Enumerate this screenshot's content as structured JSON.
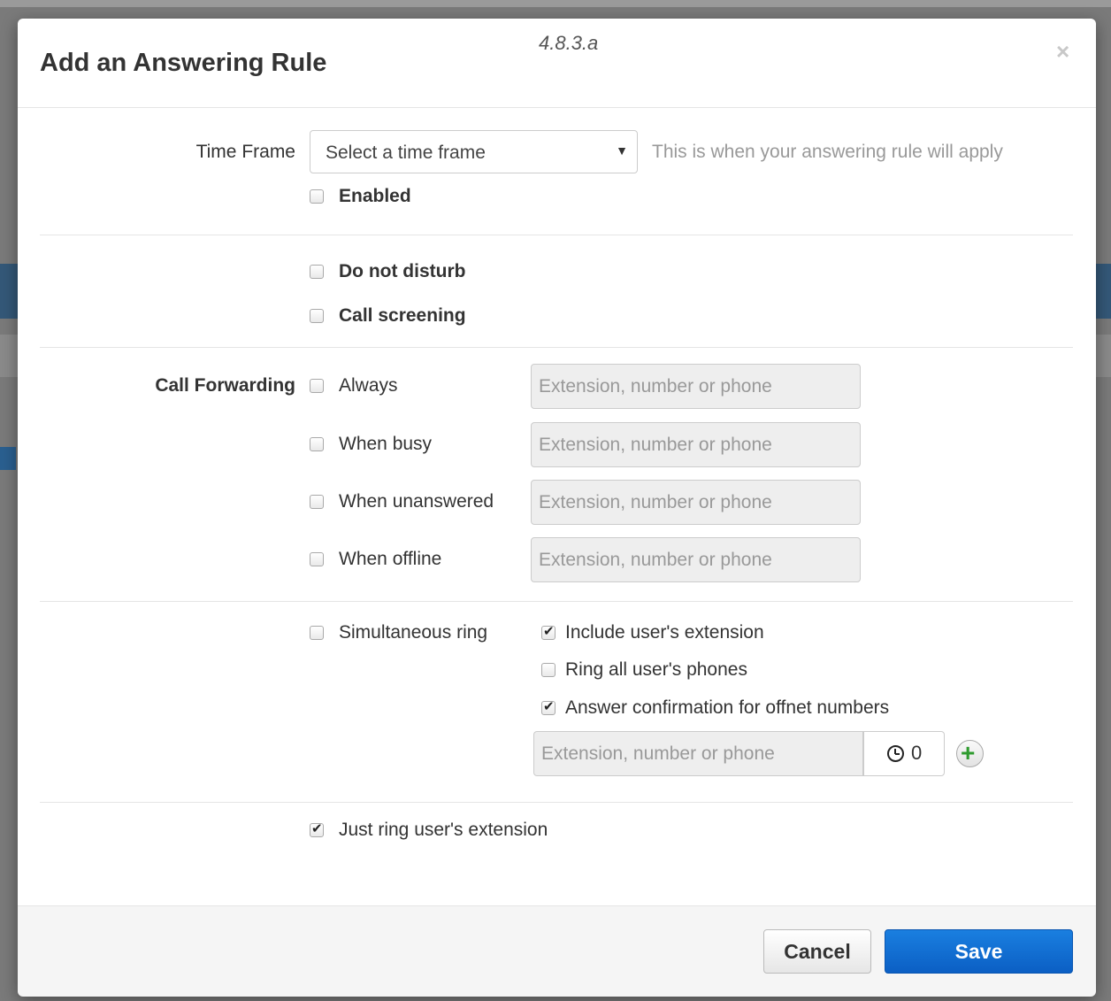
{
  "dialog": {
    "title": "Add an Answering Rule",
    "version": "4.8.3.a",
    "close_glyph": "×"
  },
  "time_frame": {
    "label": "Time Frame",
    "select_value": "Select a time frame",
    "help": "This is when your answering rule will apply",
    "enabled_label": "Enabled",
    "enabled_checked": false
  },
  "options": {
    "dnd_label": "Do not disturb",
    "screening_label": "Call screening"
  },
  "call_forwarding": {
    "label": "Call Forwarding",
    "rows": [
      {
        "label": "Always",
        "placeholder": "Extension, number or phone"
      },
      {
        "label": "When busy",
        "placeholder": "Extension, number or phone"
      },
      {
        "label": "When unanswered",
        "placeholder": "Extension, number or phone"
      },
      {
        "label": "When offline",
        "placeholder": "Extension, number or phone"
      }
    ]
  },
  "simultaneous_ring": {
    "label": "Simultaneous ring",
    "include_ext_label": "Include user's extension",
    "ring_all_label": "Ring all user's phones",
    "answer_conf_label": "Answer confirmation for offnet numbers",
    "placeholder": "Extension, number or phone",
    "delay_value": "0",
    "add_glyph": "+"
  },
  "just_ring": {
    "label": "Just ring user's extension"
  },
  "footer": {
    "cancel_label": "Cancel",
    "save_label": "Save"
  },
  "colors": {
    "primary": "#0b5fc4",
    "add_icon": "#2e9b2e"
  }
}
